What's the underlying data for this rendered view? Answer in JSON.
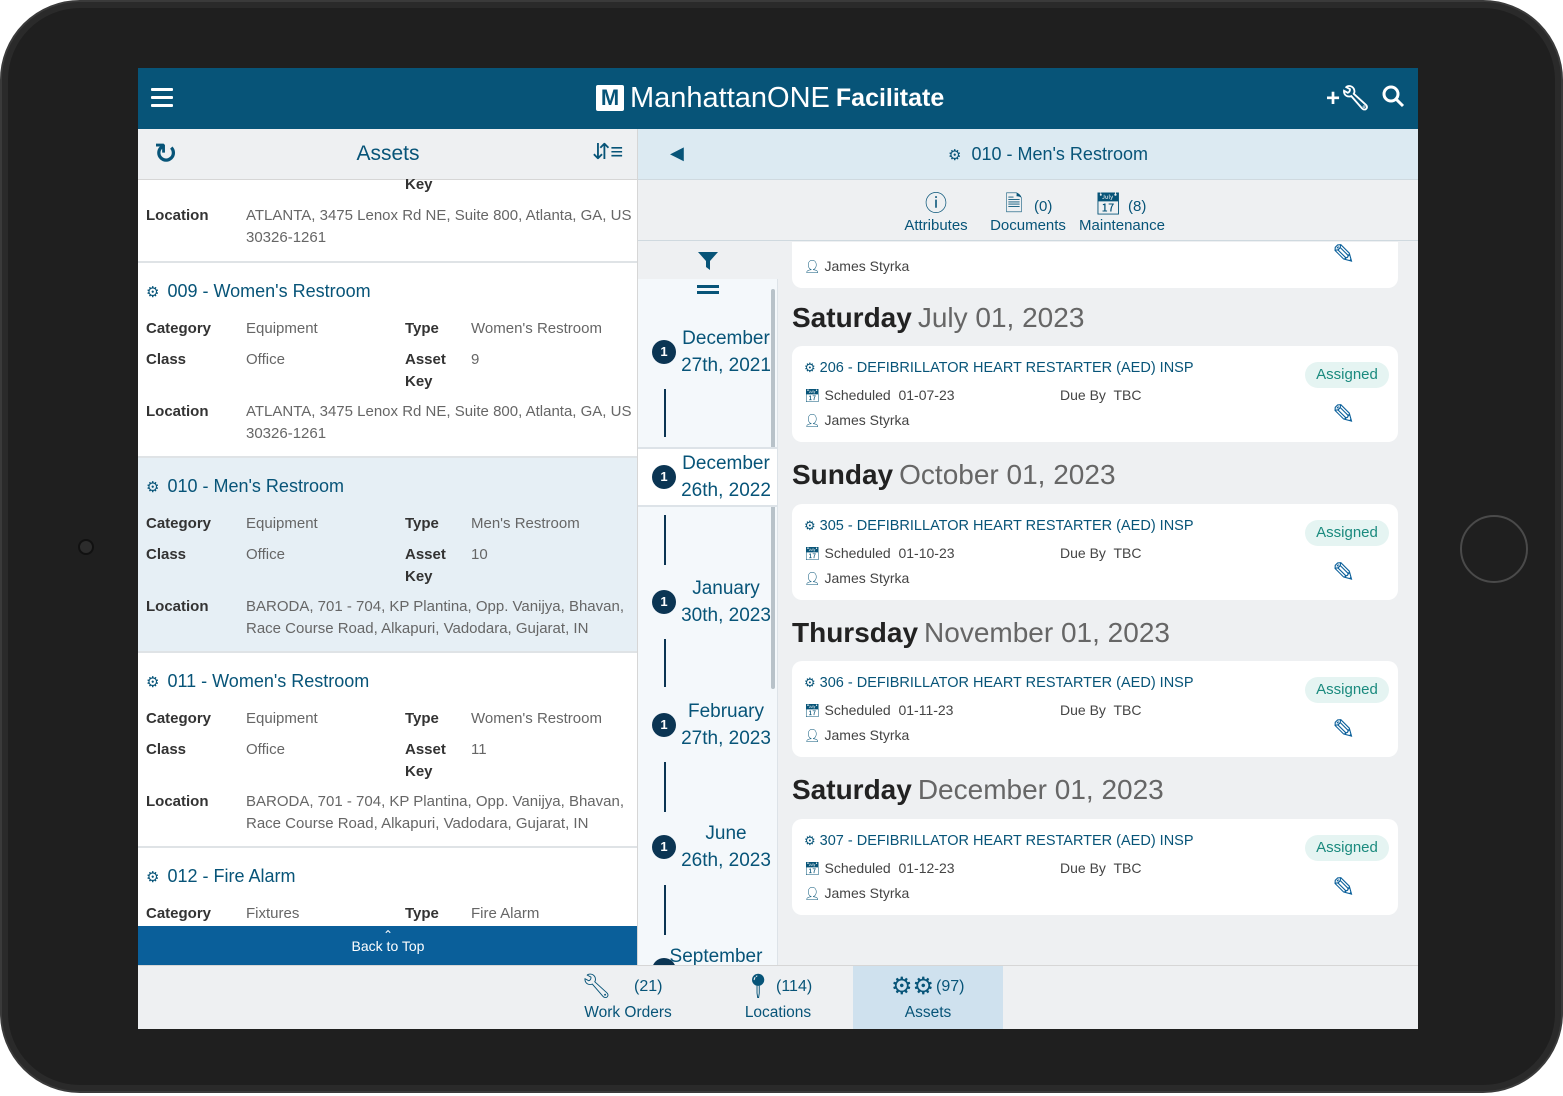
{
  "app": {
    "brand_main": "ManhattanONE",
    "brand_product": "Facilitate"
  },
  "left": {
    "title": "Assets",
    "partial": {
      "key_label": "Key",
      "location_label": "Location",
      "location": "ATLANTA, 3475 Lenox Rd NE, Suite 800, Atlanta, GA, US 30326-1261"
    },
    "cards": [
      {
        "title": "009 - Women's Restroom",
        "category": "Equipment",
        "type": "Women's Restroom",
        "class": "Office",
        "asset_key": "9",
        "location": "ATLANTA, 3475 Lenox Rd NE, Suite 800, Atlanta, GA, US 30326-1261"
      },
      {
        "title": "010 - Men's Restroom",
        "category": "Equipment",
        "type": "Men's Restroom",
        "class": "Office",
        "asset_key": "10",
        "location": "BARODA, 701 - 704, KP Plantina, Opp. Vanijya, Bhavan, Race Course Road, Alkapuri, Vadodara, Gujarat, IN"
      },
      {
        "title": "011 - Women's Restroom",
        "category": "Equipment",
        "type": "Women's Restroom",
        "class": "Office",
        "asset_key": "11",
        "location": "BARODA, 701 - 704, KP Plantina, Opp. Vanijya, Bhavan, Race Course Road, Alkapuri, Vadodara, Gujarat, IN"
      },
      {
        "title": "012 - Fire Alarm",
        "category": "Fixtures",
        "type": "Fire Alarm"
      }
    ],
    "labels": {
      "category": "Category",
      "type": "Type",
      "class": "Class",
      "asset": "Asset",
      "key": "Key",
      "location": "Location"
    },
    "back_to_top": "Back to Top"
  },
  "right": {
    "title": "010 - Men's Restroom",
    "tabs": [
      {
        "label": "Attributes",
        "count": ""
      },
      {
        "label": "Documents",
        "count": "(0)"
      },
      {
        "label": "Maintenance",
        "count": "(8)"
      }
    ],
    "timeline": [
      {
        "badge": "1",
        "line1": "December",
        "line2": "27th, 2021"
      },
      {
        "badge": "1",
        "line1": "December",
        "line2": "26th, 2022"
      },
      {
        "badge": "1",
        "line1": "January",
        "line2": "30th, 2023"
      },
      {
        "badge": "1",
        "line1": "February",
        "line2": "27th, 2023"
      },
      {
        "badge": "1",
        "line1": "June",
        "line2": "26th, 2023"
      },
      {
        "badge": "",
        "line1": "September",
        "line2": ""
      }
    ],
    "top_partial_assignee": "James Styrka",
    "days": [
      {
        "weekday": "Saturday",
        "date": "July 01, 2023",
        "wo": {
          "title": "206 - DEFIBRILLATOR HEART RESTARTER (AED) INSP",
          "scheduled_label": "Scheduled",
          "scheduled": "01-07-23",
          "due_label": "Due By",
          "due": "TBC",
          "assignee": "James Styrka",
          "status": "Assigned"
        }
      },
      {
        "weekday": "Sunday",
        "date": "October 01, 2023",
        "wo": {
          "title": "305 - DEFIBRILLATOR HEART RESTARTER (AED) INSP",
          "scheduled_label": "Scheduled",
          "scheduled": "01-10-23",
          "due_label": "Due By",
          "due": "TBC",
          "assignee": "James Styrka",
          "status": "Assigned"
        }
      },
      {
        "weekday": "Thursday",
        "date": "November 01, 2023",
        "wo": {
          "title": "306 - DEFIBRILLATOR HEART RESTARTER (AED) INSP",
          "scheduled_label": "Scheduled",
          "scheduled": "01-11-23",
          "due_label": "Due By",
          "due": "TBC",
          "assignee": "James Styrka",
          "status": "Assigned"
        }
      },
      {
        "weekday": "Saturday",
        "date": "December 01, 2023",
        "wo": {
          "title": "307 - DEFIBRILLATOR HEART RESTARTER (AED) INSP",
          "scheduled_label": "Scheduled",
          "scheduled": "01-12-23",
          "due_label": "Due By",
          "due": "TBC",
          "assignee": "James Styrka",
          "status": "Assigned"
        }
      }
    ]
  },
  "bottom_nav": [
    {
      "label": "Work Orders",
      "count": "(21)"
    },
    {
      "label": "Locations",
      "count": "(114)"
    },
    {
      "label": "Assets",
      "count": "(97)"
    }
  ],
  "colors": {
    "brand": "#075478",
    "accent": "#0a5f9a",
    "status_assigned": "#1a8a7e"
  }
}
